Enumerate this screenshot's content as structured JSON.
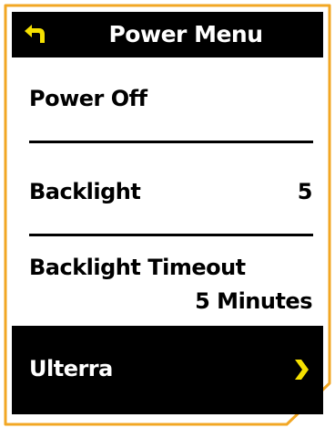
{
  "header": {
    "title": "Power Menu",
    "back_icon": "back-arrow-icon"
  },
  "menu": {
    "power_off": {
      "label": "Power Off"
    },
    "backlight": {
      "label": "Backlight",
      "value": "5"
    },
    "backlight_timeout": {
      "label": "Backlight Timeout",
      "value": "5 Minutes"
    },
    "ulterra": {
      "label": "Ulterra",
      "icon": "chevron-right-icon",
      "selected": true
    }
  },
  "colors": {
    "frame": "#F2A724",
    "accent": "#F5E000",
    "header_bg": "#000000",
    "selected_bg": "#000000",
    "text": "#000000",
    "text_inverse": "#FFFFFF"
  }
}
